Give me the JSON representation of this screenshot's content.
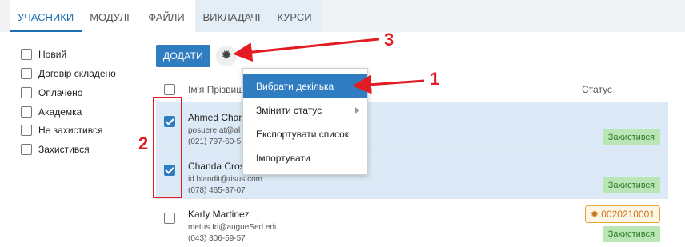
{
  "tabs": [
    {
      "label": "УЧАСНИКИ",
      "active": true
    },
    {
      "label": "МОДУЛІ"
    },
    {
      "label": "ФАЙЛИ"
    },
    {
      "label": "ВИКЛАДАЧІ"
    },
    {
      "label": "КУРСИ"
    }
  ],
  "filters": [
    "Новий",
    "Договір складено",
    "Оплачено",
    "Академка",
    "Не захистився",
    "Захистився"
  ],
  "toolbar": {
    "add_label": "ДОДАТИ",
    "gear_icon": "gear-icon",
    "more_icon": "vertical-dots-icon"
  },
  "table": {
    "header_name": "Ім'я Прізвищ",
    "header_status": "Статус",
    "rows": [
      {
        "name": "Ahmed Chan",
        "email": "posuere.at@al",
        "phone": "(021) 797-60-5",
        "status": "Захистився",
        "checked": true
      },
      {
        "name": "Chanda Cros",
        "email": "id.blandit@risus.com",
        "phone": "(078) 465-37-07",
        "status": "Захистився",
        "checked": true
      },
      {
        "name": "Karly Martinez",
        "email": "metus.In@augueSed.edu",
        "phone": "(043) 306-59-57",
        "status": "Захистився",
        "code": "0020210001",
        "checked": false
      }
    ]
  },
  "menu": {
    "items": [
      "Вибрати декілька",
      "Змінити статус",
      "Експортувати список",
      "Імпортувати"
    ]
  },
  "annotations": {
    "n1": "1",
    "n2": "2",
    "n3": "3",
    "color": "#e31b23"
  }
}
